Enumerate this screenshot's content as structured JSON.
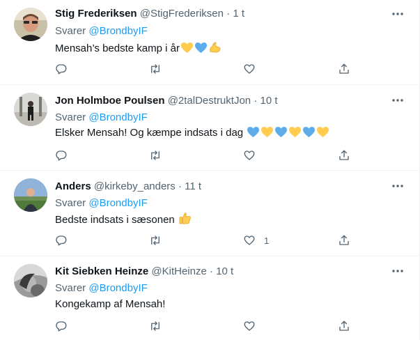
{
  "colors": {
    "name": "#0f1419",
    "secondary": "#536471",
    "link": "#1d9bf0",
    "divider": "#eff3f4",
    "heart_yellow": "#ffcc4d",
    "heart_blue": "#5dadec"
  },
  "icons": {
    "more": "more-icon",
    "reply": "reply-icon",
    "retweet": "retweet-icon",
    "like": "heart-icon",
    "share": "share-icon"
  },
  "tweets": [
    {
      "name": "Stig Frederiksen",
      "handle": "@StigFrederiksen",
      "separator": "·",
      "time": "1 t",
      "replying_prefix": "Svarer",
      "replying_to": "@BrondbyIF",
      "text": "Mensah’s bedste kamp i år",
      "emojis": [
        "yellow-heart",
        "blue-heart",
        "flexed-biceps"
      ],
      "like_count": ""
    },
    {
      "name": "Jon Holmboe Poulsen",
      "handle": "@2talDestruktJon",
      "separator": "·",
      "time": "10 t",
      "replying_prefix": "Svarer",
      "replying_to": "@BrondbyIF",
      "text": "Elsker Mensah! Og kæmpe indsats i dag",
      "emojis": [
        "blue-heart",
        "yellow-heart",
        "blue-heart",
        "yellow-heart",
        "blue-heart",
        "yellow-heart"
      ],
      "like_count": ""
    },
    {
      "name": "Anders",
      "handle": "@kirkeby_anders",
      "separator": "·",
      "time": "11 t",
      "replying_prefix": "Svarer",
      "replying_to": "@BrondbyIF",
      "text": "Bedste indsats i sæsonen",
      "emojis": [
        "thumbs-up"
      ],
      "like_count": "1"
    },
    {
      "name": "Kit Siebken Heinze",
      "handle": "@KitHeinze",
      "separator": "·",
      "time": "10 t",
      "replying_prefix": "Svarer",
      "replying_to": "@BrondbyIF",
      "text": "Kongekamp af Mensah!",
      "emojis": [],
      "like_count": ""
    }
  ]
}
